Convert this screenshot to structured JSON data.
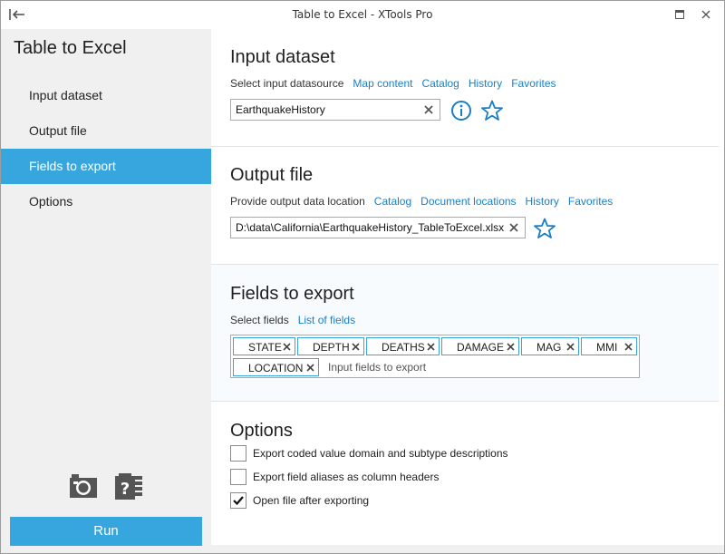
{
  "window": {
    "title": "Table to Excel  -  XTools Pro"
  },
  "sidebar": {
    "heading": "Table to Excel",
    "items": [
      {
        "label": "Input dataset"
      },
      {
        "label": "Output file"
      },
      {
        "label": "Fields to export"
      },
      {
        "label": "Options"
      }
    ],
    "active_index": 2,
    "run_label": "Run"
  },
  "input_dataset": {
    "title": "Input dataset",
    "source_label": "Select input datasource",
    "links": [
      "Map content",
      "Catalog",
      "History",
      "Favorites"
    ],
    "value": "EarthquakeHistory"
  },
  "output_file": {
    "title": "Output file",
    "location_label": "Provide output data location",
    "links": [
      "Catalog",
      "Document locations",
      "History",
      "Favorites"
    ],
    "value": "D:\\data\\California\\EarthquakeHistory_TableToExcel.xlsx"
  },
  "fields": {
    "title": "Fields to export",
    "select_label": "Select fields",
    "link": "List of fields",
    "tags": [
      "STATE",
      "DEPTH",
      "DEATHS",
      "DAMAGE",
      "MAG",
      "MMI",
      "LOCATION"
    ],
    "input_placeholder": "Input fields to export"
  },
  "options": {
    "title": "Options",
    "items": [
      {
        "label": "Export coded value domain and subtype descriptions",
        "checked": false
      },
      {
        "label": "Export field aliases as column headers",
        "checked": false
      },
      {
        "label": "Open file after exporting",
        "checked": true
      }
    ]
  },
  "colors": {
    "accent": "#37a6df",
    "link": "#1a7fc4"
  },
  "icons": {
    "back": "back-arrow-icon",
    "maximize": "maximize-icon",
    "close": "close-icon",
    "camera": "camera-icon",
    "help": "help-clipboard-icon",
    "info": "info-icon",
    "favorite": "star-icon",
    "clear": "clear-x-icon"
  }
}
